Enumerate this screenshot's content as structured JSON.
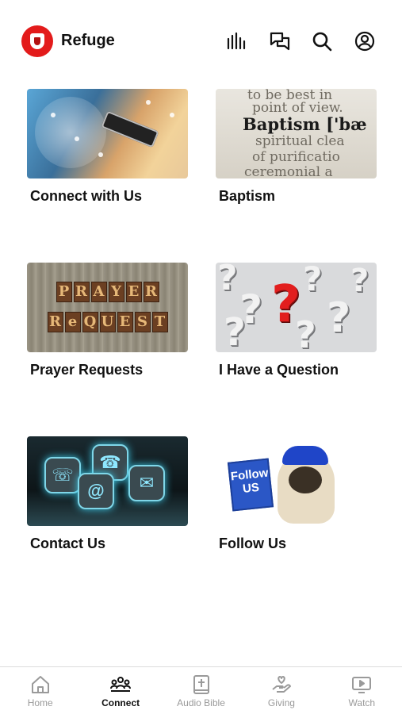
{
  "header": {
    "app_title": "Refuge",
    "icons": [
      "audio-bars-icon",
      "chat-icon",
      "search-icon",
      "profile-icon"
    ]
  },
  "grid": {
    "items": [
      {
        "label": "Connect with Us"
      },
      {
        "label": "Baptism"
      },
      {
        "label": "Prayer Requests"
      },
      {
        "label": "I Have a Question"
      },
      {
        "label": "Contact Us"
      },
      {
        "label": "Follow Us"
      }
    ]
  },
  "thumbnail_text": {
    "baptism_lines": [
      "to be best in",
      "point of view.",
      "Baptism ['bæ",
      "spiritual clea",
      "of purificatio",
      "ceremonial a"
    ],
    "prayer_row1": [
      "P",
      "R",
      "A",
      "Y",
      "E",
      "R"
    ],
    "prayer_row2": [
      "R",
      "e",
      "Q",
      "U",
      "E",
      "S",
      "T"
    ],
    "follow_sign": "Follow US"
  },
  "bottom_nav": {
    "items": [
      {
        "label": "Home",
        "icon": "home-icon",
        "active": false
      },
      {
        "label": "Connect",
        "icon": "people-icon",
        "active": true
      },
      {
        "label": "Audio Bible",
        "icon": "bible-icon",
        "active": false
      },
      {
        "label": "Giving",
        "icon": "giving-hand-icon",
        "active": false
      },
      {
        "label": "Watch",
        "icon": "tv-play-icon",
        "active": false
      }
    ]
  },
  "colors": {
    "brand_red": "#e31b1b",
    "active_nav": "#111111",
    "inactive_nav": "#9a9a9a"
  }
}
